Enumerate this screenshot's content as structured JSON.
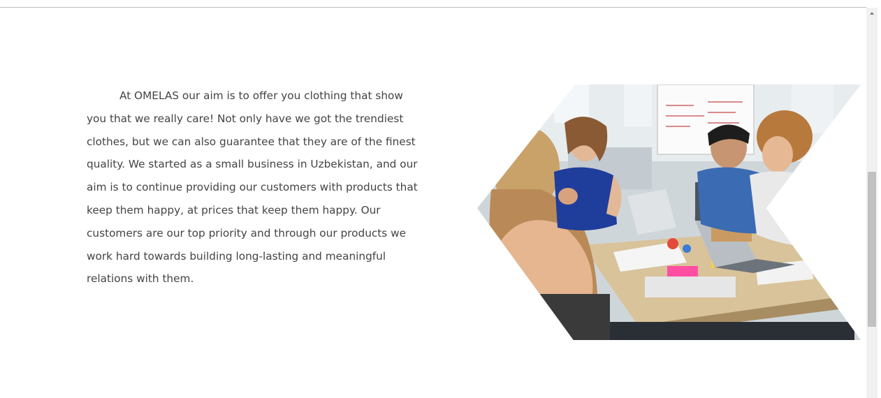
{
  "about": {
    "paragraph": "At OMELAS our aim is to offer you clothing that show you that we really care! Not only have we got the trendiest clothes, but we can also guarantee that they are of the finest quality. We started as a small business in Uzbekistan, and our aim is to continue providing our customers with products that keep them happy, at prices that keep them happy. Our customers are our top priority and through our products we work hard towards building long-lasting and meaningful relations with them."
  },
  "image": {
    "subject": "team-meeting-photo"
  },
  "colors": {
    "text": "#444444",
    "background": "#ffffff",
    "scrollbar_track": "#f1f1f1",
    "scrollbar_thumb": "#c1c1c1"
  }
}
